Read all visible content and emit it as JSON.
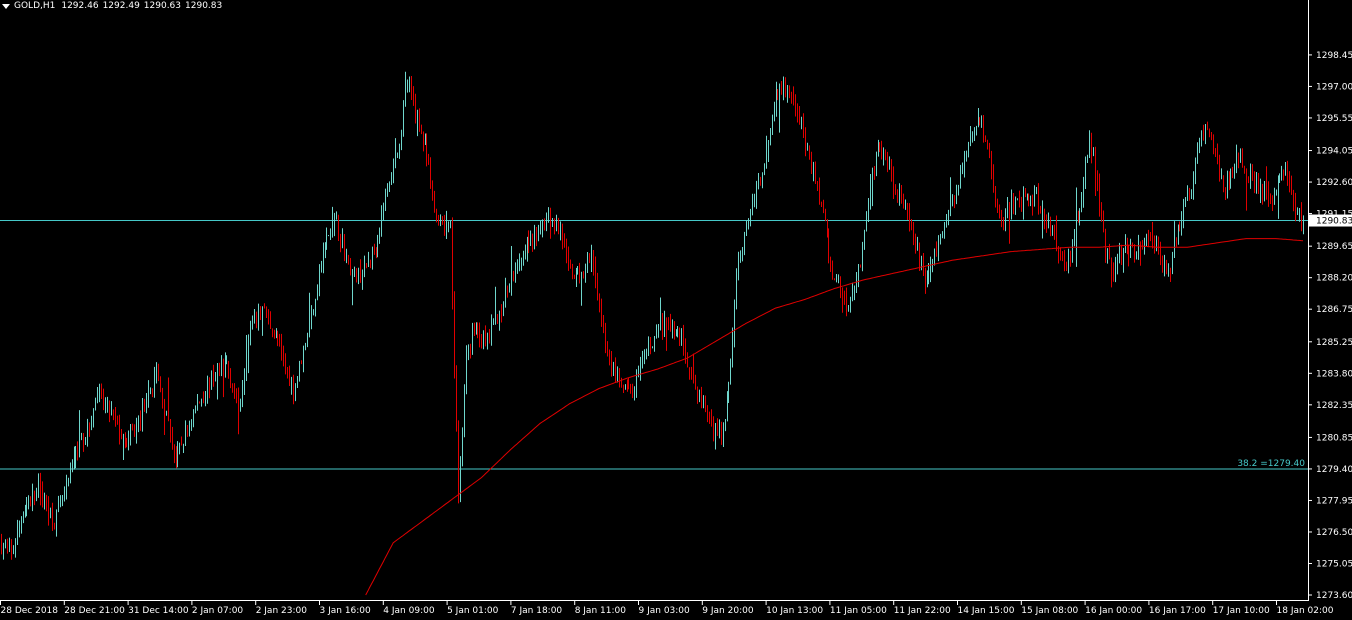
{
  "header": {
    "symbol": "GOLD,H1",
    "open": "1292.46",
    "high": "1292.49",
    "low": "1290.63",
    "close": "1290.83"
  },
  "colors": {
    "background": "#000000",
    "bull": "#6fd6cc",
    "bear": "#e00000",
    "ma": "#e00000",
    "hline": "#46c8c8",
    "axis": "#ffffff",
    "price_badge_bg": "#ffffff",
    "price_badge_text": "#000000"
  },
  "chart_data": {
    "type": "candlestick",
    "symbol": "GOLD",
    "timeframe": "H1",
    "ylim": [
      1273.6,
      1299.55
    ],
    "y_ticks": [
      "1298.45",
      "1297.00",
      "1295.55",
      "1294.05",
      "1292.60",
      "1291.15",
      "1289.65",
      "1288.20",
      "1286.75",
      "1285.25",
      "1283.80",
      "1282.35",
      "1280.85",
      "1279.40",
      "1277.95",
      "1276.50",
      "1275.05",
      "1273.60"
    ],
    "x_labels": [
      "28 Dec 2018",
      "28 Dec 21:00",
      "31 Dec 14:00",
      "2 Jan 07:00",
      "2 Jan 23:00",
      "3 Jan 16:00",
      "4 Jan 09:00",
      "5 Jan 01:00",
      "7 Jan 18:00",
      "8 Jan 11:00",
      "9 Jan 03:00",
      "9 Jan 20:00",
      "10 Jan 13:00",
      "11 Jan 05:00",
      "11 Jan 22:00",
      "14 Jan 15:00",
      "15 Jan 08:00",
      "16 Jan 00:00",
      "16 Jan 17:00",
      "17 Jan 10:00",
      "18 Jan 02:00"
    ],
    "current_price": "1290.83",
    "fib_level": {
      "label": "38.2 =1279.40",
      "value": 1279.4
    },
    "path_anchors": [
      [
        0,
        1276.0
      ],
      [
        6,
        1275.5
      ],
      [
        12,
        1277.5
      ],
      [
        20,
        1278.5
      ],
      [
        28,
        1277.0
      ],
      [
        34,
        1278.5
      ],
      [
        40,
        1280.5
      ],
      [
        46,
        1281.3
      ],
      [
        50,
        1282.8
      ],
      [
        58,
        1281.8
      ],
      [
        64,
        1280.5
      ],
      [
        70,
        1281.3
      ],
      [
        80,
        1283.8
      ],
      [
        90,
        1279.8
      ],
      [
        100,
        1282.2
      ],
      [
        110,
        1283.8
      ],
      [
        116,
        1284.3
      ],
      [
        122,
        1282.2
      ],
      [
        128,
        1285.8
      ],
      [
        134,
        1286.8
      ],
      [
        142,
        1285.2
      ],
      [
        150,
        1283.0
      ],
      [
        158,
        1286.0
      ],
      [
        166,
        1289.8
      ],
      [
        172,
        1290.8
      ],
      [
        180,
        1288.2
      ],
      [
        186,
        1288.5
      ],
      [
        192,
        1289.8
      ],
      [
        198,
        1292.3
      ],
      [
        204,
        1294.5
      ],
      [
        208,
        1297.1
      ],
      [
        212,
        1296.0
      ],
      [
        218,
        1293.7
      ],
      [
        222,
        1291.2
      ],
      [
        230,
        1290.3
      ],
      [
        234,
        1278.0
      ],
      [
        238,
        1284.5
      ],
      [
        242,
        1286.0
      ],
      [
        248,
        1285.2
      ],
      [
        256,
        1286.8
      ],
      [
        262,
        1288.6
      ],
      [
        268,
        1289.6
      ],
      [
        274,
        1290.3
      ],
      [
        280,
        1291.0
      ],
      [
        286,
        1290.4
      ],
      [
        290,
        1288.5
      ],
      [
        296,
        1288.2
      ],
      [
        302,
        1289.0
      ],
      [
        306,
        1286.8
      ],
      [
        310,
        1284.8
      ],
      [
        316,
        1283.2
      ],
      [
        322,
        1282.8
      ],
      [
        326,
        1283.6
      ],
      [
        330,
        1284.8
      ],
      [
        336,
        1285.8
      ],
      [
        342,
        1286.0
      ],
      [
        348,
        1285.5
      ],
      [
        354,
        1283.2
      ],
      [
        358,
        1282.6
      ],
      [
        364,
        1281.3
      ],
      [
        368,
        1280.8
      ],
      [
        372,
        1283.0
      ],
      [
        376,
        1288.5
      ],
      [
        380,
        1290.3
      ],
      [
        384,
        1291.5
      ],
      [
        388,
        1292.8
      ],
      [
        392,
        1294.5
      ],
      [
        396,
        1296.5
      ],
      [
        400,
        1297.1
      ],
      [
        404,
        1296.3
      ],
      [
        408,
        1295.5
      ],
      [
        412,
        1293.9
      ],
      [
        416,
        1292.6
      ],
      [
        420,
        1291.2
      ],
      [
        424,
        1288.5
      ],
      [
        428,
        1288.0
      ],
      [
        432,
        1286.9
      ],
      [
        436,
        1287.8
      ],
      [
        440,
        1289.5
      ],
      [
        444,
        1292.4
      ],
      [
        448,
        1294.1
      ],
      [
        452,
        1293.8
      ],
      [
        456,
        1292.5
      ],
      [
        460,
        1292.0
      ],
      [
        464,
        1290.6
      ],
      [
        468,
        1289.5
      ],
      [
        472,
        1288.0
      ],
      [
        476,
        1289.0
      ],
      [
        480,
        1290.0
      ],
      [
        484,
        1291.3
      ],
      [
        488,
        1292.1
      ],
      [
        492,
        1293.8
      ],
      [
        496,
        1295.1
      ],
      [
        500,
        1295.5
      ],
      [
        504,
        1294.3
      ],
      [
        508,
        1291.5
      ],
      [
        512,
        1290.8
      ],
      [
        516,
        1291.6
      ],
      [
        520,
        1291.5
      ],
      [
        524,
        1291.8
      ],
      [
        528,
        1292.2
      ],
      [
        532,
        1291.0
      ],
      [
        536,
        1290.5
      ],
      [
        540,
        1289.4
      ],
      [
        544,
        1288.6
      ],
      [
        548,
        1290.2
      ],
      [
        552,
        1292.0
      ],
      [
        556,
        1294.6
      ],
      [
        560,
        1292.5
      ],
      [
        564,
        1289.3
      ],
      [
        568,
        1288.6
      ],
      [
        572,
        1289.2
      ],
      [
        576,
        1289.5
      ],
      [
        580,
        1289.6
      ],
      [
        584,
        1289.8
      ],
      [
        588,
        1290.2
      ],
      [
        592,
        1289.2
      ],
      [
        596,
        1288.3
      ],
      [
        600,
        1290.0
      ],
      [
        604,
        1291.5
      ],
      [
        608,
        1292.2
      ],
      [
        612,
        1294.6
      ],
      [
        616,
        1295.2
      ],
      [
        620,
        1293.8
      ],
      [
        624,
        1292.3
      ],
      [
        628,
        1292.8
      ],
      [
        632,
        1294.0
      ],
      [
        636,
        1293.1
      ],
      [
        640,
        1292.4
      ],
      [
        644,
        1292.1
      ],
      [
        648,
        1291.6
      ],
      [
        652,
        1292.6
      ],
      [
        656,
        1293.2
      ],
      [
        660,
        1291.6
      ],
      [
        664,
        1290.8
      ]
    ],
    "ma_anchors": [
      [
        186,
        1273.6
      ],
      [
        200,
        1276.0
      ],
      [
        215,
        1277.0
      ],
      [
        230,
        1278.0
      ],
      [
        245,
        1279.0
      ],
      [
        260,
        1280.3
      ],
      [
        275,
        1281.5
      ],
      [
        290,
        1282.4
      ],
      [
        305,
        1283.1
      ],
      [
        320,
        1283.6
      ],
      [
        335,
        1284.0
      ],
      [
        350,
        1284.5
      ],
      [
        365,
        1285.3
      ],
      [
        380,
        1286.1
      ],
      [
        395,
        1286.8
      ],
      [
        410,
        1287.2
      ],
      [
        425,
        1287.7
      ],
      [
        440,
        1288.1
      ],
      [
        455,
        1288.4
      ],
      [
        470,
        1288.7
      ],
      [
        485,
        1289.0
      ],
      [
        500,
        1289.2
      ],
      [
        515,
        1289.4
      ],
      [
        530,
        1289.5
      ],
      [
        545,
        1289.6
      ],
      [
        560,
        1289.6
      ],
      [
        575,
        1289.7
      ],
      [
        590,
        1289.6
      ],
      [
        605,
        1289.6
      ],
      [
        620,
        1289.8
      ],
      [
        635,
        1290.0
      ],
      [
        650,
        1290.0
      ],
      [
        664,
        1289.9
      ]
    ],
    "n_candles": 665,
    "grid": false
  }
}
